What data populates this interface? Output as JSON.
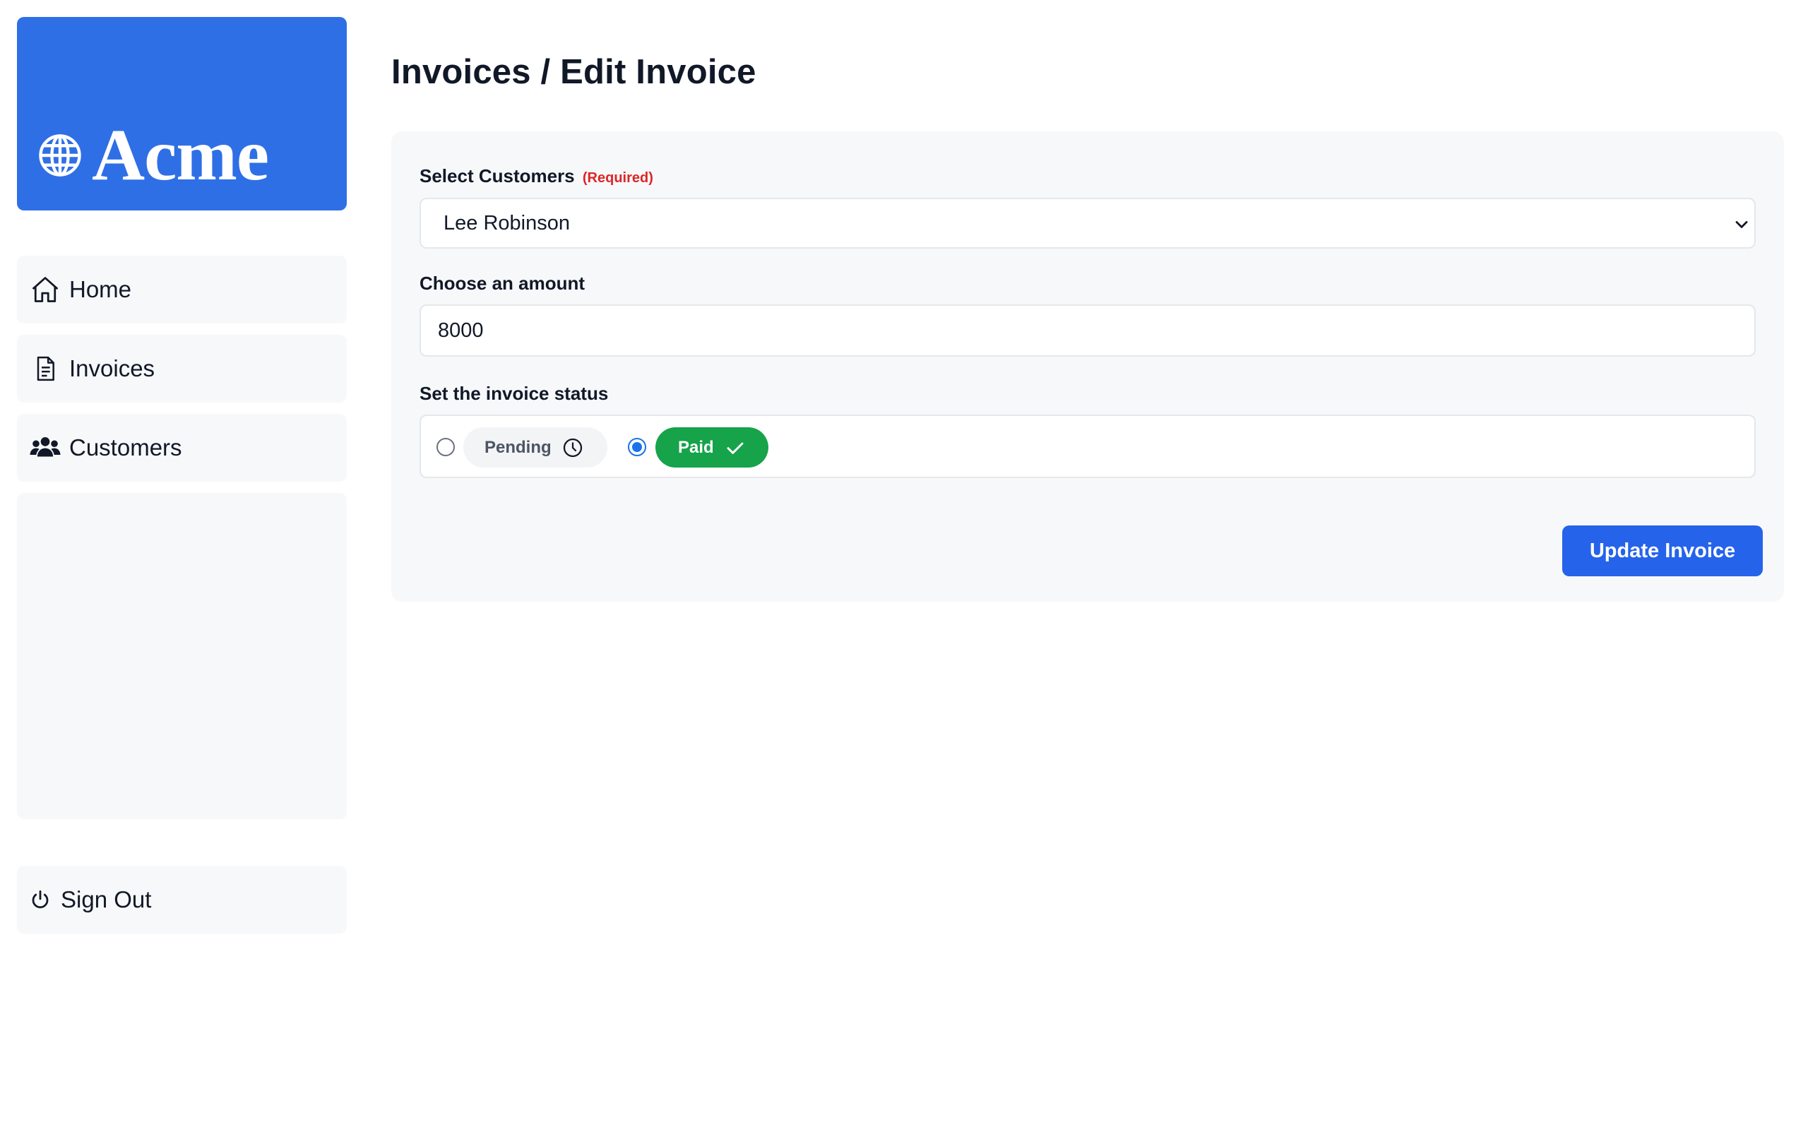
{
  "brand": {
    "name": "Acme",
    "icon": "globe-icon",
    "color": "#2f6fe6"
  },
  "sidebar": {
    "items": [
      {
        "label": "Home",
        "icon": "home-icon"
      },
      {
        "label": "Invoices",
        "icon": "document-icon"
      },
      {
        "label": "Customers",
        "icon": "users-icon"
      }
    ],
    "signout": {
      "label": "Sign Out",
      "icon": "power-icon"
    }
  },
  "header": {
    "title": "Invoices / Edit Invoice"
  },
  "form": {
    "customer": {
      "label": "Select Customers",
      "required_label": "(Required)",
      "selected": "Lee Robinson"
    },
    "amount": {
      "label": "Choose an amount",
      "value": "8000"
    },
    "status": {
      "label": "Set the invoice status",
      "selected": "paid",
      "options": [
        {
          "label": "Pending",
          "icon": "clock-icon",
          "color": "#f3f4f6"
        },
        {
          "label": "Paid",
          "icon": "check-icon",
          "color": "#16a34a"
        }
      ]
    },
    "submit_label": "Update Invoice",
    "accent_color": "#2563eb",
    "required_color": "#dc2626"
  }
}
